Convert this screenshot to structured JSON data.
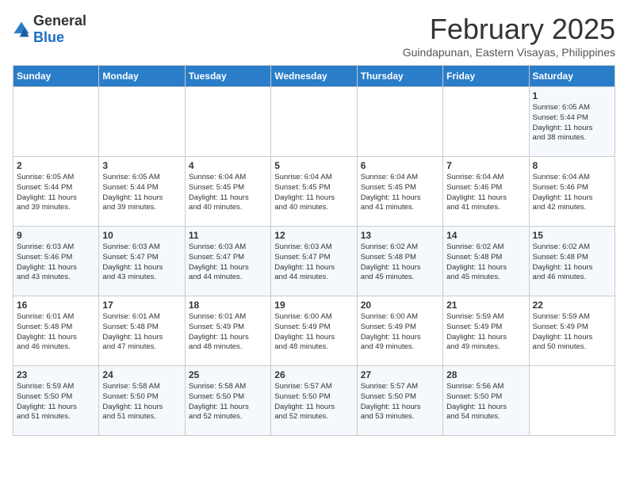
{
  "header": {
    "logo": {
      "general": "General",
      "blue": "Blue"
    },
    "month_title": "February 2025",
    "subtitle": "Guindapunan, Eastern Visayas, Philippines"
  },
  "days_of_week": [
    "Sunday",
    "Monday",
    "Tuesday",
    "Wednesday",
    "Thursday",
    "Friday",
    "Saturday"
  ],
  "weeks": [
    {
      "days": [
        {
          "num": "",
          "info": ""
        },
        {
          "num": "",
          "info": ""
        },
        {
          "num": "",
          "info": ""
        },
        {
          "num": "",
          "info": ""
        },
        {
          "num": "",
          "info": ""
        },
        {
          "num": "",
          "info": ""
        },
        {
          "num": "1",
          "info": "Sunrise: 6:05 AM\nSunset: 5:44 PM\nDaylight: 11 hours\nand 38 minutes."
        }
      ]
    },
    {
      "days": [
        {
          "num": "2",
          "info": "Sunrise: 6:05 AM\nSunset: 5:44 PM\nDaylight: 11 hours\nand 39 minutes."
        },
        {
          "num": "3",
          "info": "Sunrise: 6:05 AM\nSunset: 5:44 PM\nDaylight: 11 hours\nand 39 minutes."
        },
        {
          "num": "4",
          "info": "Sunrise: 6:04 AM\nSunset: 5:45 PM\nDaylight: 11 hours\nand 40 minutes."
        },
        {
          "num": "5",
          "info": "Sunrise: 6:04 AM\nSunset: 5:45 PM\nDaylight: 11 hours\nand 40 minutes."
        },
        {
          "num": "6",
          "info": "Sunrise: 6:04 AM\nSunset: 5:45 PM\nDaylight: 11 hours\nand 41 minutes."
        },
        {
          "num": "7",
          "info": "Sunrise: 6:04 AM\nSunset: 5:46 PM\nDaylight: 11 hours\nand 41 minutes."
        },
        {
          "num": "8",
          "info": "Sunrise: 6:04 AM\nSunset: 5:46 PM\nDaylight: 11 hours\nand 42 minutes."
        }
      ]
    },
    {
      "days": [
        {
          "num": "9",
          "info": "Sunrise: 6:03 AM\nSunset: 5:46 PM\nDaylight: 11 hours\nand 43 minutes."
        },
        {
          "num": "10",
          "info": "Sunrise: 6:03 AM\nSunset: 5:47 PM\nDaylight: 11 hours\nand 43 minutes."
        },
        {
          "num": "11",
          "info": "Sunrise: 6:03 AM\nSunset: 5:47 PM\nDaylight: 11 hours\nand 44 minutes."
        },
        {
          "num": "12",
          "info": "Sunrise: 6:03 AM\nSunset: 5:47 PM\nDaylight: 11 hours\nand 44 minutes."
        },
        {
          "num": "13",
          "info": "Sunrise: 6:02 AM\nSunset: 5:48 PM\nDaylight: 11 hours\nand 45 minutes."
        },
        {
          "num": "14",
          "info": "Sunrise: 6:02 AM\nSunset: 5:48 PM\nDaylight: 11 hours\nand 45 minutes."
        },
        {
          "num": "15",
          "info": "Sunrise: 6:02 AM\nSunset: 5:48 PM\nDaylight: 11 hours\nand 46 minutes."
        }
      ]
    },
    {
      "days": [
        {
          "num": "16",
          "info": "Sunrise: 6:01 AM\nSunset: 5:48 PM\nDaylight: 11 hours\nand 46 minutes."
        },
        {
          "num": "17",
          "info": "Sunrise: 6:01 AM\nSunset: 5:48 PM\nDaylight: 11 hours\nand 47 minutes."
        },
        {
          "num": "18",
          "info": "Sunrise: 6:01 AM\nSunset: 5:49 PM\nDaylight: 11 hours\nand 48 minutes."
        },
        {
          "num": "19",
          "info": "Sunrise: 6:00 AM\nSunset: 5:49 PM\nDaylight: 11 hours\nand 48 minutes."
        },
        {
          "num": "20",
          "info": "Sunrise: 6:00 AM\nSunset: 5:49 PM\nDaylight: 11 hours\nand 49 minutes."
        },
        {
          "num": "21",
          "info": "Sunrise: 5:59 AM\nSunset: 5:49 PM\nDaylight: 11 hours\nand 49 minutes."
        },
        {
          "num": "22",
          "info": "Sunrise: 5:59 AM\nSunset: 5:49 PM\nDaylight: 11 hours\nand 50 minutes."
        }
      ]
    },
    {
      "days": [
        {
          "num": "23",
          "info": "Sunrise: 5:59 AM\nSunset: 5:50 PM\nDaylight: 11 hours\nand 51 minutes."
        },
        {
          "num": "24",
          "info": "Sunrise: 5:58 AM\nSunset: 5:50 PM\nDaylight: 11 hours\nand 51 minutes."
        },
        {
          "num": "25",
          "info": "Sunrise: 5:58 AM\nSunset: 5:50 PM\nDaylight: 11 hours\nand 52 minutes."
        },
        {
          "num": "26",
          "info": "Sunrise: 5:57 AM\nSunset: 5:50 PM\nDaylight: 11 hours\nand 52 minutes."
        },
        {
          "num": "27",
          "info": "Sunrise: 5:57 AM\nSunset: 5:50 PM\nDaylight: 11 hours\nand 53 minutes."
        },
        {
          "num": "28",
          "info": "Sunrise: 5:56 AM\nSunset: 5:50 PM\nDaylight: 11 hours\nand 54 minutes."
        },
        {
          "num": "",
          "info": ""
        }
      ]
    }
  ]
}
